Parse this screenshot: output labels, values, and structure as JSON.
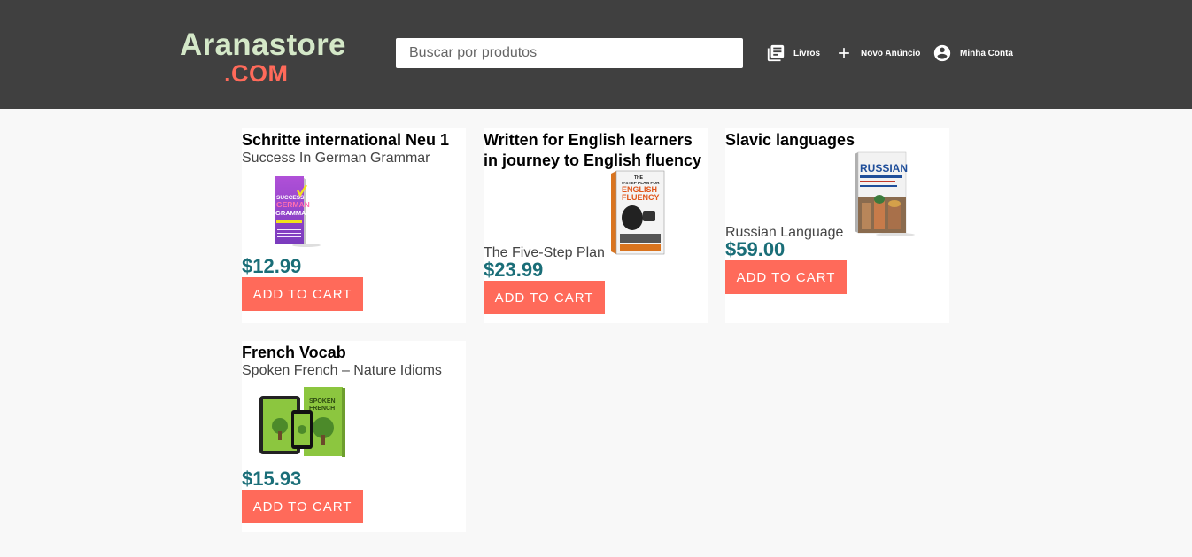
{
  "header": {
    "logo_main": "Aranastore",
    "logo_sub": ".COM",
    "search_placeholder": "Buscar por produtos",
    "nav": {
      "livros": "Livros",
      "novo_anuncio": "Novo Anúncio",
      "minha_conta": "Minha Conta"
    }
  },
  "products": [
    {
      "title": "Schritte international Neu 1",
      "subtitle": "Success In German Grammar",
      "price": "$12.99",
      "button": "ADD TO CART",
      "cover": {
        "l1": "SUCCESS IN",
        "l2": "GERMAN",
        "l3": "GRAMMAR"
      }
    },
    {
      "title": "Written for English learners in journey to English fluency",
      "subtitle": "The Five-Step Plan",
      "price": "$23.99",
      "button": "ADD TO CART",
      "cover": {
        "l1": "THE",
        "l2": "5-STEP PLAN FOR",
        "l3": "ENGLISH",
        "l4": "FLUENCY"
      }
    },
    {
      "title": "Slavic languages",
      "subtitle": "Russian Language",
      "price": "$59.00",
      "button": "ADD TO CART",
      "cover": {
        "l1": "RUSSIAN"
      }
    },
    {
      "title": "French Vocab",
      "subtitle": "Spoken French – Nature Idioms",
      "price": "$15.93",
      "button": "ADD TO CART",
      "cover": {
        "l1": "SPOKEN",
        "l2": "FRENCH"
      }
    }
  ],
  "colors": {
    "header_bg": "#404040",
    "accent": "#ff6a5a",
    "price": "#1a6e78",
    "logo": "#d4e8c8"
  }
}
